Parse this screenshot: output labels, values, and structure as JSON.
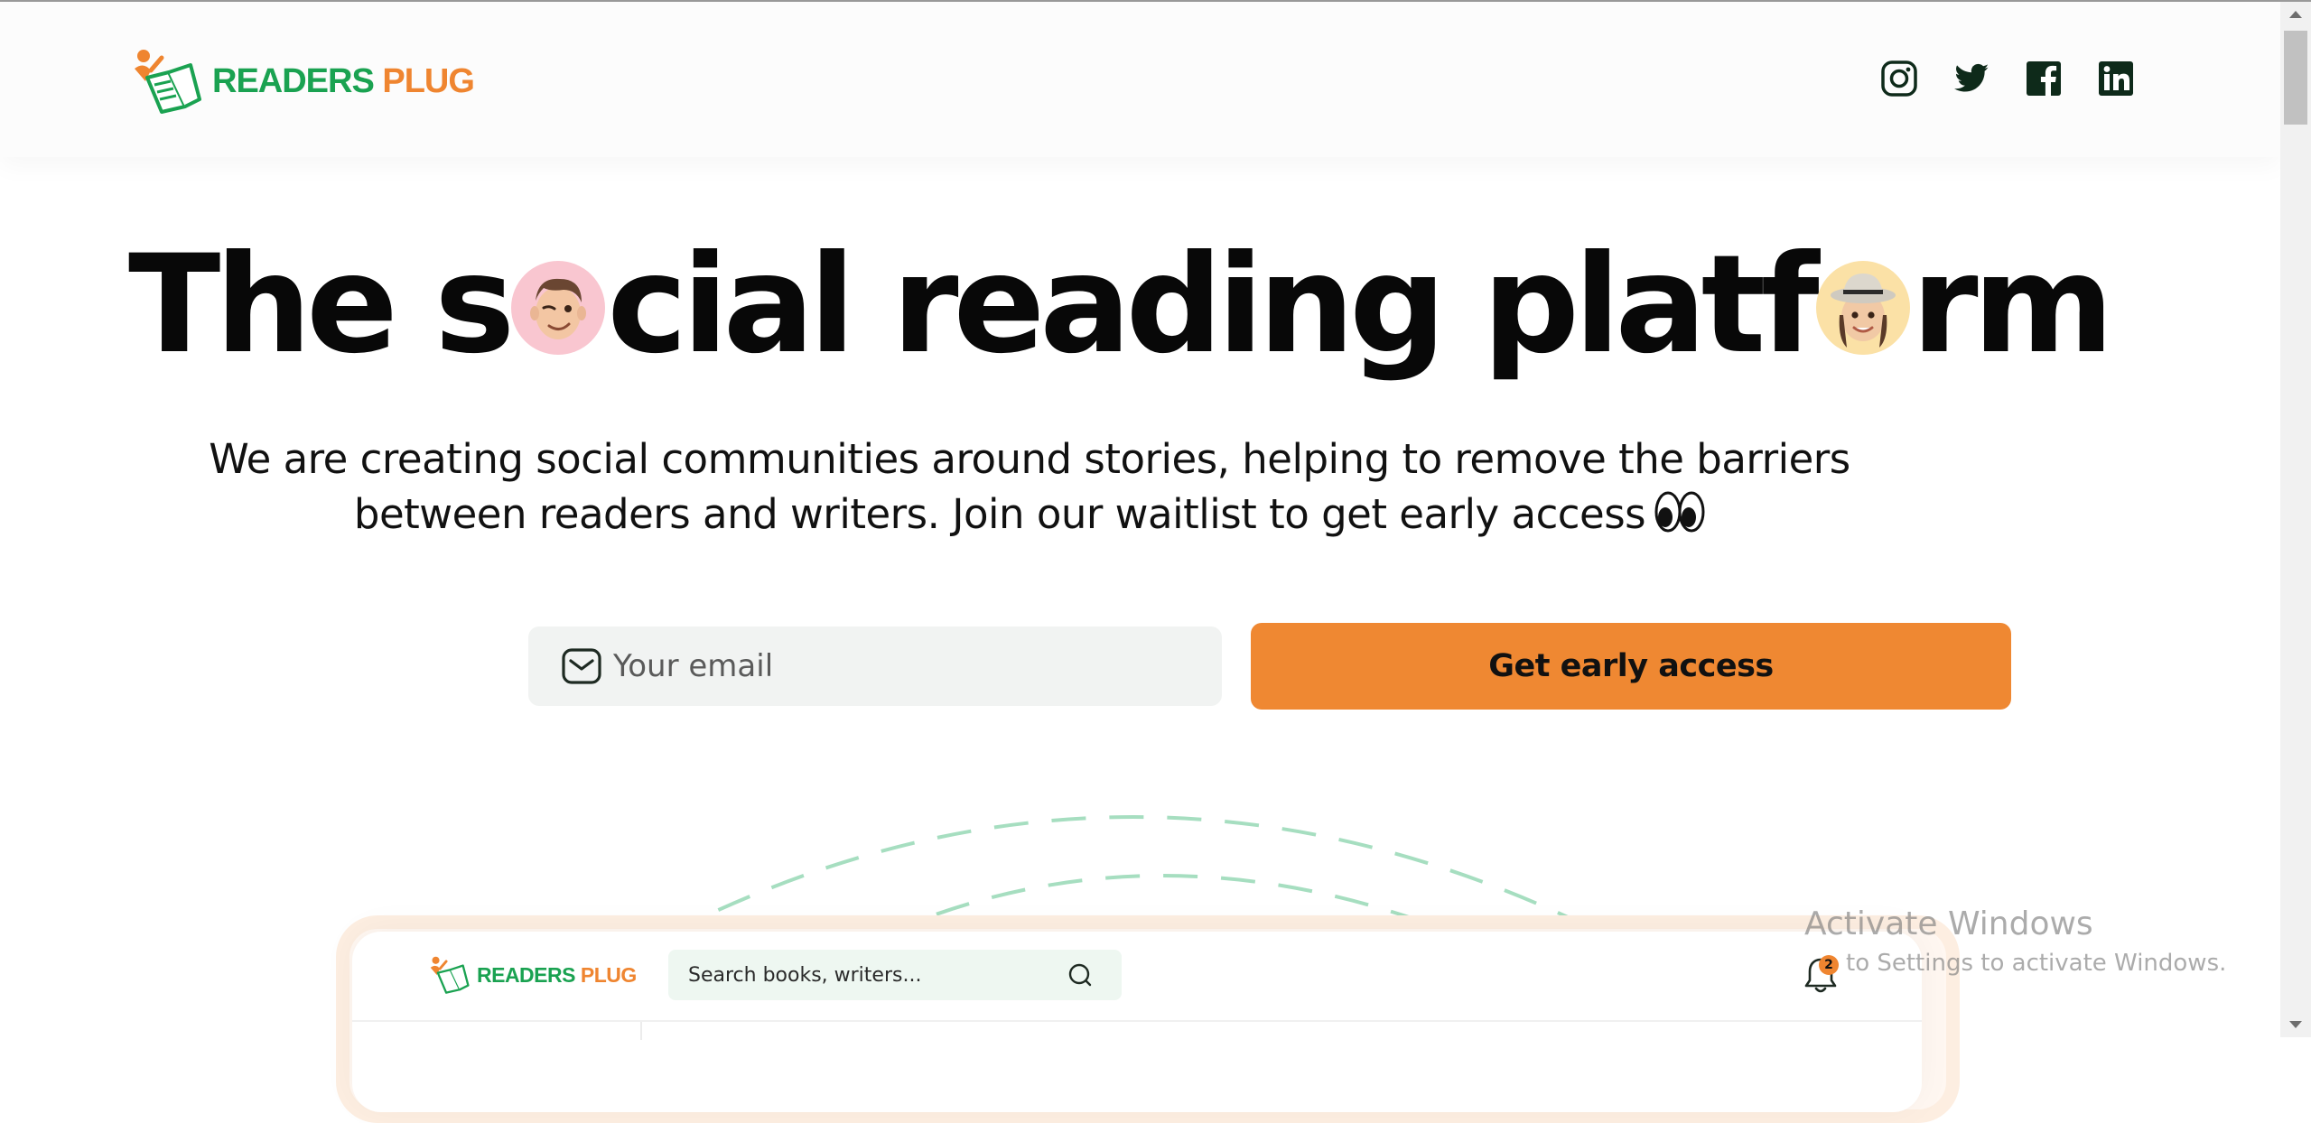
{
  "header": {
    "brand": {
      "part1": "READERS",
      "part2": "PLUG"
    },
    "socials": [
      {
        "name": "instagram-icon"
      },
      {
        "name": "twitter-icon"
      },
      {
        "name": "facebook-icon"
      },
      {
        "name": "linkedin-icon"
      }
    ]
  },
  "hero": {
    "title_parts": [
      "The s",
      "cial reading platf",
      "rm"
    ],
    "avatars": [
      "winking-man-memoji",
      "woman-hat-memoji"
    ],
    "subtitle_line1": "We are creating social communities around stories, helping to remove the barriers",
    "subtitle_line2": "between readers and writers. Join our waitlist to get early access",
    "subtitle_emoji": "eyes-emoji"
  },
  "form": {
    "email_placeholder": "Your email",
    "cta_label": "Get early access"
  },
  "preview": {
    "brand": {
      "part1": "READERS",
      "part2": "PLUG"
    },
    "search_placeholder": "Search books, writers...",
    "notification_count": "2"
  },
  "watermark": {
    "title": "Activate Windows",
    "subtitle": "to Settings to activate Windows."
  },
  "colors": {
    "brand_green": "#1aa251",
    "brand_orange": "#ef8530",
    "cta": "#ef8832",
    "dash_green": "#a6dec0"
  }
}
